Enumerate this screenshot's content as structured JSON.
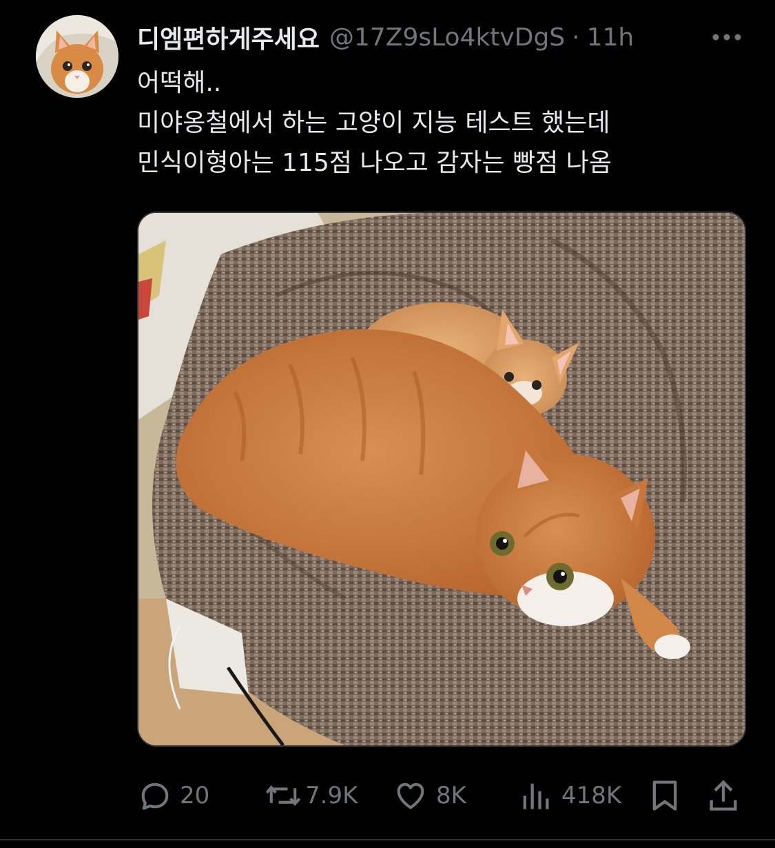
{
  "tweet": {
    "display_name": "디엠편하게주세요",
    "handle": "@17Z9sLo4ktvDgS",
    "separator": "·",
    "time": "11h",
    "text_lines": [
      "어떡해..",
      "미야옹철에서 하는 고양이 지능 테스트 했는데",
      "민식이형아는 115점 나오고 감자는 빵점 나옴"
    ],
    "media": {
      "description_icon": "photo-two-orange-cats-on-blanket"
    },
    "actions": {
      "reply_count": "20",
      "retweet_count": "7.9K",
      "like_count": "8K",
      "view_count": "418K"
    }
  },
  "colors": {
    "background": "#000000",
    "primary_text": "#e7e9ea",
    "secondary_text": "#71767b",
    "border": "#2f3336"
  },
  "icons": {
    "more": "more-dots-icon",
    "reply": "reply-bubble-icon",
    "retweet": "retweet-icon",
    "like": "heart-icon",
    "views": "views-bar-chart-icon",
    "bookmark": "bookmark-icon",
    "share": "share-upload-icon"
  }
}
